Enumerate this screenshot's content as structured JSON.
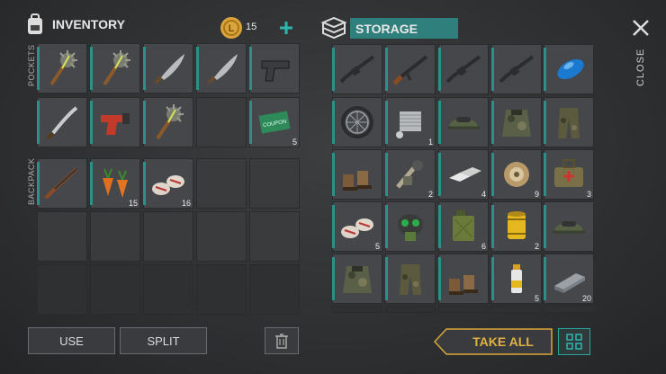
{
  "inventory": {
    "title": "INVENTORY",
    "coin_count": "15",
    "pockets_label": "POCKETS",
    "backpack_label": "BACKPACK"
  },
  "storage": {
    "title": "STORAGE",
    "close_label": "CLOSE"
  },
  "buttons": {
    "use": "USE",
    "split": "SPLIT",
    "take_all": "TAKE ALL"
  },
  "accent": "#2b8f8a",
  "pockets": [
    {
      "icon": "spiked-club-icon",
      "count": ""
    },
    {
      "icon": "spiked-club-icon",
      "count": ""
    },
    {
      "icon": "machete-icon",
      "count": ""
    },
    {
      "icon": "machete-icon",
      "count": ""
    },
    {
      "icon": "pistol-icon",
      "count": ""
    },
    {
      "icon": "katana-icon",
      "count": ""
    },
    {
      "icon": "flare-gun-icon",
      "count": ""
    },
    {
      "icon": "spiked-club-icon",
      "count": ""
    },
    {
      "icon": "",
      "count": ""
    },
    {
      "icon": "ration-coupon-icon",
      "count": "5"
    }
  ],
  "backpack": [
    {
      "icon": "shotgun-icon",
      "count": ""
    },
    {
      "icon": "carrot-icon",
      "count": "15"
    },
    {
      "icon": "bandage-icon",
      "count": "16"
    }
  ],
  "storage_items": [
    {
      "icon": "rifle-icon",
      "count": ""
    },
    {
      "icon": "ak-rifle-icon",
      "count": ""
    },
    {
      "icon": "rifle-icon",
      "count": ""
    },
    {
      "icon": "rifle-icon",
      "count": ""
    },
    {
      "icon": "gas-tank-icon",
      "count": ""
    },
    {
      "icon": "wheel-icon",
      "count": ""
    },
    {
      "icon": "engine-icon",
      "count": "1"
    },
    {
      "icon": "helmet-icon",
      "count": ""
    },
    {
      "icon": "camo-vest-icon",
      "count": ""
    },
    {
      "icon": "camo-pants-icon",
      "count": ""
    },
    {
      "icon": "boots-icon",
      "count": ""
    },
    {
      "icon": "weapon-parts-icon",
      "count": "2"
    },
    {
      "icon": "metal-bars-icon",
      "count": "4"
    },
    {
      "icon": "wire-spool-icon",
      "count": "9"
    },
    {
      "icon": "medic-bag-icon",
      "count": "3"
    },
    {
      "icon": "bandage-icon",
      "count": "5"
    },
    {
      "icon": "gas-mask-icon",
      "count": ""
    },
    {
      "icon": "jerrycan-icon",
      "count": "6"
    },
    {
      "icon": "oil-filter-icon",
      "count": "2"
    },
    {
      "icon": "helmet-icon",
      "count": ""
    },
    {
      "icon": "camo-vest-icon",
      "count": ""
    },
    {
      "icon": "camo-pants-icon",
      "count": ""
    },
    {
      "icon": "boots-icon",
      "count": ""
    },
    {
      "icon": "spray-can-icon",
      "count": "5"
    },
    {
      "icon": "metal-plate-icon",
      "count": "20"
    }
  ]
}
